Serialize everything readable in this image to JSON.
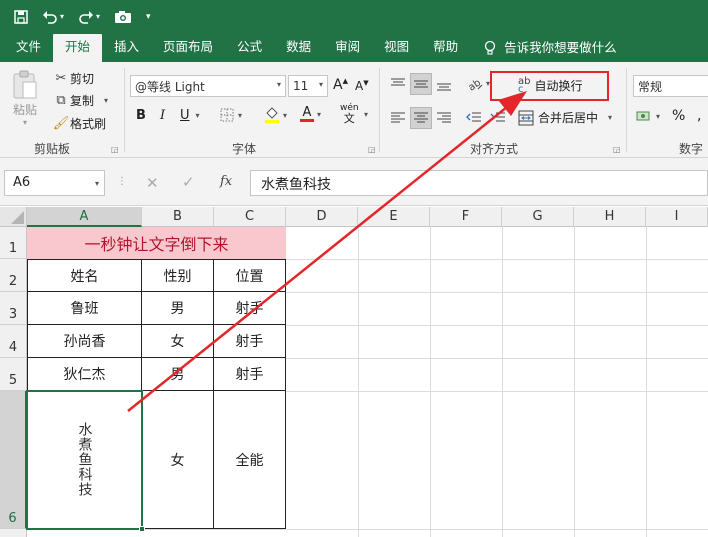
{
  "quick_access": {
    "save_icon": "save-icon",
    "undo_icon": "undo-icon",
    "redo_icon": "redo-icon",
    "camera_icon": "camera-icon",
    "customize_icon": "customize-icon"
  },
  "tabs": [
    {
      "label": "文件"
    },
    {
      "label": "开始"
    },
    {
      "label": "插入"
    },
    {
      "label": "页面布局"
    },
    {
      "label": "公式"
    },
    {
      "label": "数据"
    },
    {
      "label": "审阅"
    },
    {
      "label": "视图"
    },
    {
      "label": "帮助"
    }
  ],
  "tell_me": "告诉我你想要做什么",
  "clipboard": {
    "paste": "粘贴",
    "cut": "剪切",
    "copy": "复制",
    "format_painter": "格式刷",
    "group_label": "剪贴板"
  },
  "font": {
    "name": "@等线 Light",
    "size": "11",
    "bold": "B",
    "italic": "I",
    "underline": "U",
    "grow": "A",
    "shrink": "A",
    "font_color_letter": "A",
    "phonetic": "wén",
    "phonetic_char": "文",
    "group_label": "字体"
  },
  "alignment": {
    "wrap_text": "自动换行",
    "merge_center": "合并后居中",
    "group_label": "对齐方式",
    "wrap_icon_letters": "ab",
    "wrap_icon_letter": "c"
  },
  "number": {
    "format": "常规",
    "percent": "%",
    "comma": ",",
    "group_label": "数字"
  },
  "formula_bar": {
    "name_box": "A6",
    "fx": "fx",
    "content": "水煮鱼科技"
  },
  "columns": [
    "A",
    "B",
    "C",
    "D",
    "E",
    "F",
    "G",
    "H",
    "I"
  ],
  "rows": [
    "1",
    "2",
    "3",
    "4",
    "5",
    "6"
  ],
  "sheet": {
    "title": "一秒钟让文字倒下来",
    "headers": [
      "姓名",
      "性别",
      "位置"
    ],
    "records": [
      [
        "鲁班",
        "男",
        "射手"
      ],
      [
        "孙尚香",
        "女",
        "射手"
      ],
      [
        "狄仁杰",
        "男",
        "射手"
      ],
      [
        "水煮鱼科技",
        "女",
        "全能"
      ]
    ]
  },
  "colors": {
    "brand": "#217346",
    "title_fill": "#f9c8cf",
    "title_text": "#b0152b",
    "annotation": "#e3262a"
  }
}
